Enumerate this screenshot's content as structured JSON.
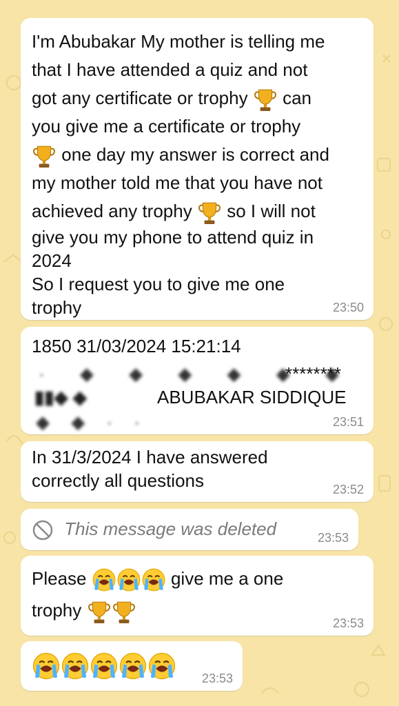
{
  "colors": {
    "wallpaper": "#f7e4a6",
    "bubble": "#ffffff",
    "time": "#8a8a8a"
  },
  "messages": [
    {
      "time": "23:50",
      "lines": [
        "I'm Abubakar My mother is telling me",
        "that I have attended a quiz and not",
        "got any certificate or trophy",
        "can",
        "you give me a  certificate or trophy",
        "one day my answer is correct and",
        "my mother told me that you have not",
        "achieved any trophy",
        "so I will not",
        "give you my phone to attend quiz in",
        "2024",
        "So I request you to give me one",
        "trophy"
      ]
    },
    {
      "time": "23:51",
      "line1": "1850 31/03/2024 15:21:14",
      "stars": "********",
      "name": "ABUBAKAR SIDDIQUE",
      "redacted_icon": "blurred-redaction"
    },
    {
      "time": "23:52",
      "lines": [
        "In 31/3/2024 I have answered",
        "correctly all questions"
      ]
    },
    {
      "time": "23:53",
      "text": "This message was deleted",
      "icon": "prohibited-icon"
    },
    {
      "time": "23:53",
      "part1": "Please",
      "part2": "give me a one",
      "part3": "trophy",
      "emoji_cry": "loudly-crying-face",
      "emoji_trophy": "trophy"
    },
    {
      "time": "23:53",
      "emoji_cry_count": 5
    }
  ]
}
